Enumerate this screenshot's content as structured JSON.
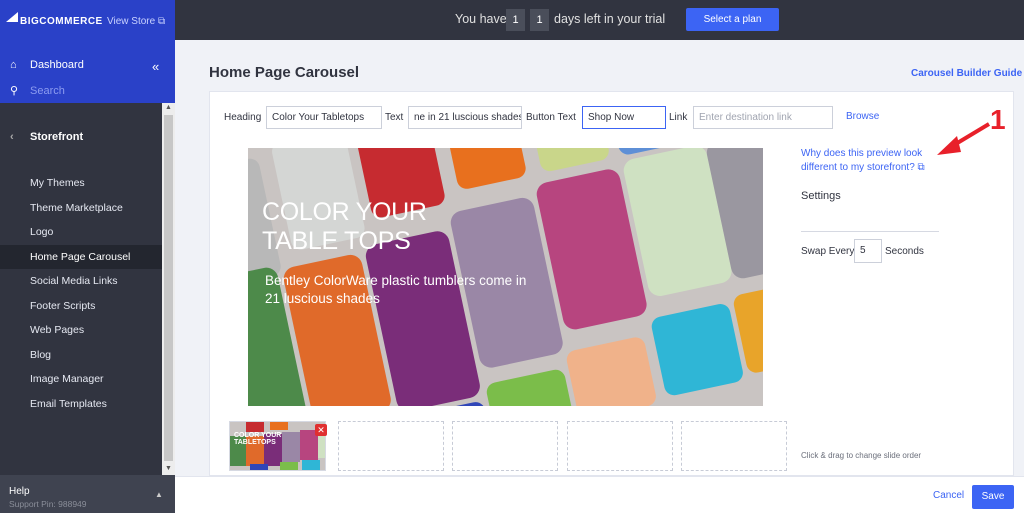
{
  "sidebar": {
    "brand": "BIGCOMMERCE",
    "view_store": "View Store",
    "dashboard": "Dashboard",
    "search_placeholder": "Search",
    "section": "Storefront",
    "items": [
      {
        "label": "My Themes"
      },
      {
        "label": "Theme Marketplace"
      },
      {
        "label": "Logo"
      },
      {
        "label": "Home Page Carousel"
      },
      {
        "label": "Social Media Links"
      },
      {
        "label": "Footer Scripts"
      },
      {
        "label": "Web Pages"
      },
      {
        "label": "Blog"
      },
      {
        "label": "Image Manager"
      },
      {
        "label": "Email Templates"
      }
    ],
    "active_item": "Home Page Carousel",
    "help": "Help",
    "support_pin": "Support Pin: 988949"
  },
  "trial": {
    "prefix": "You have",
    "digit1": "1",
    "digit2": "1",
    "suffix": "days left in your trial",
    "button": "Select a plan"
  },
  "page": {
    "title": "Home Page Carousel",
    "guide_link": "Carousel Builder Guide"
  },
  "form": {
    "heading_label": "Heading",
    "heading_value": "Color Your Tabletops",
    "text_label": "Text",
    "text_value": "ne in 21 luscious shades",
    "button_text_label": "Button Text",
    "button_text_value": "Shop Now",
    "link_label": "Link",
    "link_placeholder": "Enter destination link",
    "browse": "Browse"
  },
  "preview": {
    "heading": "COLOR YOUR\nTABLE TOPS",
    "subtext": "Bentley ColorWare plastic tumblers come in 21 luscious shades"
  },
  "right": {
    "why_link": "Why does this preview look different to my storefront?",
    "settings": "Settings",
    "swap_every": "Swap Every",
    "swap_value": "5",
    "seconds": "Seconds",
    "drag_hint": "Click & drag to change slide order"
  },
  "annotation": {
    "number": "1"
  },
  "thumbnail": {
    "text": "COLOR YOUR\nTABLETOPS"
  },
  "footer": {
    "cancel": "Cancel",
    "save": "Save"
  },
  "colors": {
    "accent": "#3c64f4",
    "sidebar": "#313440",
    "brand_blue": "#2a41c8",
    "annotation": "#e8202a"
  }
}
